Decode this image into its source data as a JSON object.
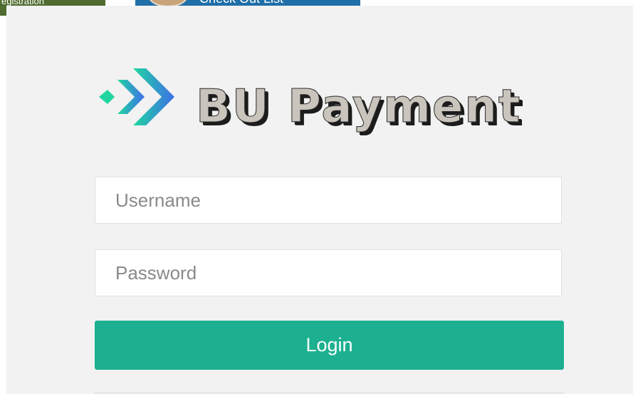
{
  "background": {
    "left_banner_text": "egistration",
    "right_banner_text": "Check Out List"
  },
  "logo": {
    "icon": "chevron-arrows-icon",
    "text": "BU Payment"
  },
  "form": {
    "username_placeholder": "Username",
    "password_placeholder": "Password",
    "login_label": "Login"
  },
  "colors": {
    "accent": "#1cb090",
    "modal_background": "#f2f2f2",
    "logo_gradient_start": "#1fd6a0",
    "logo_gradient_end": "#3f6fe8"
  }
}
